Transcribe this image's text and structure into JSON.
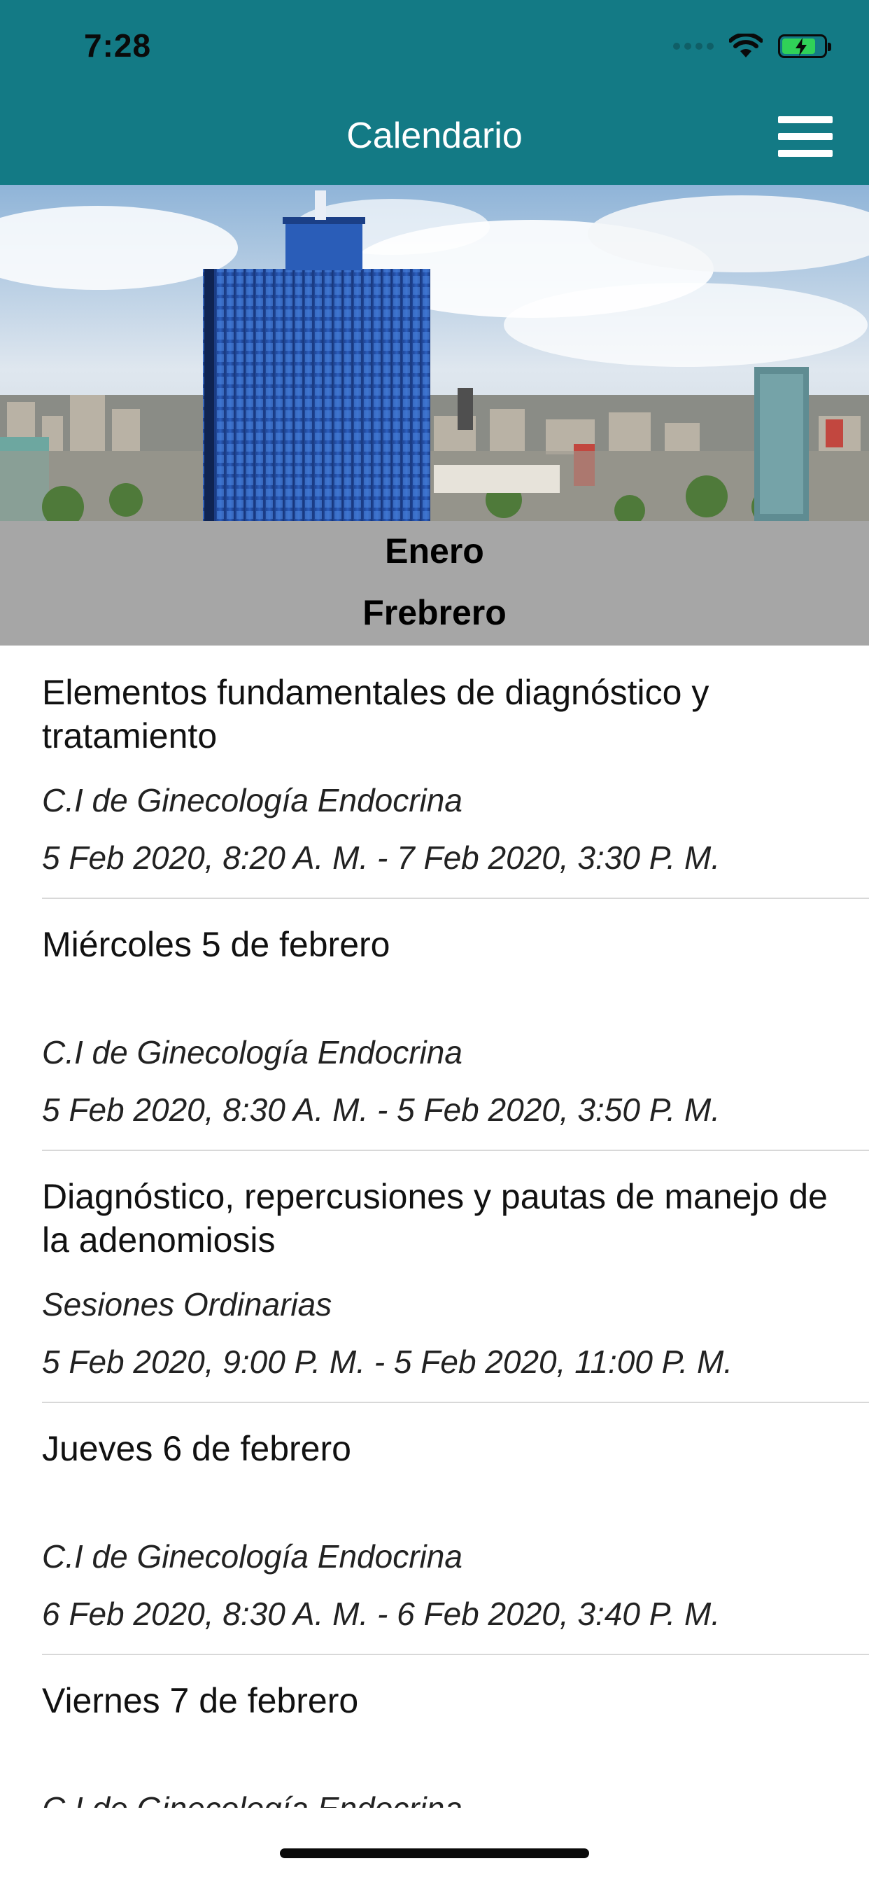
{
  "status": {
    "time": "7:28"
  },
  "nav": {
    "title": "Calendario"
  },
  "months": [
    "Enero",
    "Frebrero"
  ],
  "events": [
    {
      "title": "Elementos fundamentales de diagnóstico y tratamiento",
      "category": "C.I de Ginecología Endocrina",
      "dates": "5 Feb 2020, 8:20 A. M. - 7 Feb 2020, 3:30 P. M."
    },
    {
      "title": "Miércoles 5 de febrero",
      "category": "C.I de Ginecología Endocrina",
      "dates": "5 Feb 2020, 8:30 A. M. - 5 Feb 2020, 3:50 P. M."
    },
    {
      "title": "Diagnóstico, repercusiones y pautas de manejo de la adenomiosis",
      "category": "Sesiones Ordinarias",
      "dates": "5 Feb 2020, 9:00 P. M. - 5 Feb 2020, 11:00 P. M."
    },
    {
      "title": "Jueves 6 de febrero",
      "category": "C.I de Ginecología Endocrina",
      "dates": "6 Feb 2020, 8:30 A. M. - 6 Feb 2020, 3:40 P. M."
    },
    {
      "title": "Viernes 7 de febrero",
      "category": "C.I de Ginecología Endocrina",
      "dates": ""
    }
  ],
  "colors": {
    "header": "#137a85",
    "months_bg": "#a6a6a6",
    "divider": "#d8d8d8"
  },
  "icons": {
    "menu": "hamburger-menu-icon",
    "wifi": "wifi-icon",
    "battery": "battery-charging-icon"
  }
}
